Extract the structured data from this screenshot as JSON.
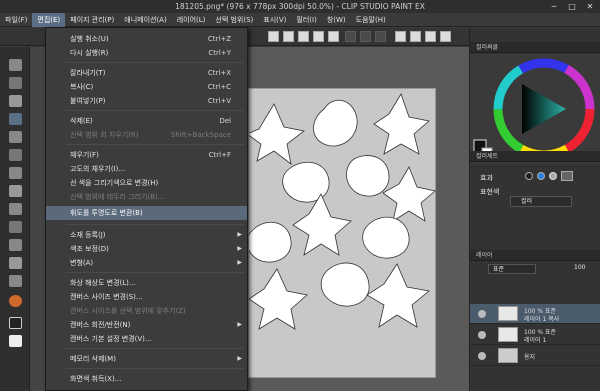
{
  "window": {
    "title": "181205.png* (976 x 778px 300dpi 50.0%)  - CLIP STUDIO PAINT EX",
    "min": "─",
    "max": "□",
    "close": "✕"
  },
  "menubar": {
    "items": [
      {
        "label": "파일(F)"
      },
      {
        "label": "편집(E)"
      },
      {
        "label": "페이지 관리(P)"
      },
      {
        "label": "애니메이션(A)"
      },
      {
        "label": "레이어(L)"
      },
      {
        "label": "선택 범위(S)"
      },
      {
        "label": "표시(V)"
      },
      {
        "label": "필터(I)"
      },
      {
        "label": "창(W)"
      },
      {
        "label": "도움말(H)"
      }
    ]
  },
  "edit_menu": {
    "items": [
      {
        "label": "실행 취소(U)",
        "shortcut": "Ctrl+Z",
        "disabled": false
      },
      {
        "label": "다시 실행(R)",
        "shortcut": "Ctrl+Y",
        "disabled": false
      },
      {
        "label": "잘라내기(T)",
        "shortcut": "Ctrl+X",
        "disabled": false
      },
      {
        "label": "복사(C)",
        "shortcut": "Ctrl+C",
        "disabled": false
      },
      {
        "label": "붙여넣기(P)",
        "shortcut": "Ctrl+V",
        "disabled": false
      },
      {
        "label": "삭제(E)",
        "shortcut": "Del",
        "disabled": false
      },
      {
        "label": "선택 범위 외 지우기(R)",
        "shortcut": "Shift+BackSpace",
        "disabled": true
      },
      {
        "label": "채우기(F)",
        "shortcut": "Ctrl+F",
        "disabled": false
      },
      {
        "label": "고도의 채우기(I)...",
        "shortcut": "",
        "disabled": false
      },
      {
        "label": "선 색을 그리기색으로 변경(H)",
        "shortcut": "",
        "disabled": false
      },
      {
        "label": "선택 범위에 테두리 그리기(B)...",
        "shortcut": "",
        "disabled": true
      },
      {
        "label": "휘도를 투명도로 변환(B)",
        "shortcut": "",
        "disabled": false,
        "highlight": true
      },
      {
        "label": "소재 등록(J)",
        "shortcut": "",
        "disabled": false,
        "submenu": true
      },
      {
        "label": "색조 보정(D)",
        "shortcut": "",
        "disabled": false,
        "submenu": true
      },
      {
        "label": "변형(A)",
        "shortcut": "",
        "disabled": false,
        "submenu": true
      },
      {
        "label": "화상 해상도 변경(L)...",
        "shortcut": "",
        "disabled": false
      },
      {
        "label": "캔버스 사이즈 변경(S)...",
        "shortcut": "",
        "disabled": false
      },
      {
        "label": "캔버스 사이즈를 선택 범위에 맞추기(Z)",
        "shortcut": "",
        "disabled": true
      },
      {
        "label": "캔버스 회전/반전(N)",
        "shortcut": "",
        "disabled": false,
        "submenu": true
      },
      {
        "label": "캔버스 기본 설정 변경(V)...",
        "shortcut": "",
        "disabled": false
      },
      {
        "label": "메모리 삭제(M)",
        "shortcut": "",
        "disabled": false,
        "submenu": true
      },
      {
        "label": "화면색 취득(X)...",
        "shortcut": "",
        "disabled": false
      }
    ]
  },
  "right_panel": {
    "color_tabs": "컬러써클",
    "sub_tabs": "컬러세트",
    "effects_label": "효과",
    "expression_label": "표현색",
    "expression_value": "컬러",
    "layer_tab": "레이어",
    "blend_mode": "표준",
    "opacity": "100",
    "layers": [
      {
        "mode": "100 % 표준",
        "name": "레이어 1 복사"
      },
      {
        "mode": "100 % 표준",
        "name": "레이어 1"
      },
      {
        "mode": "",
        "name": "용지"
      }
    ]
  },
  "colors": {
    "menu_bg": "#3c3c3c",
    "highlight": "#5a6a7a",
    "accent": "#5a6f85"
  }
}
